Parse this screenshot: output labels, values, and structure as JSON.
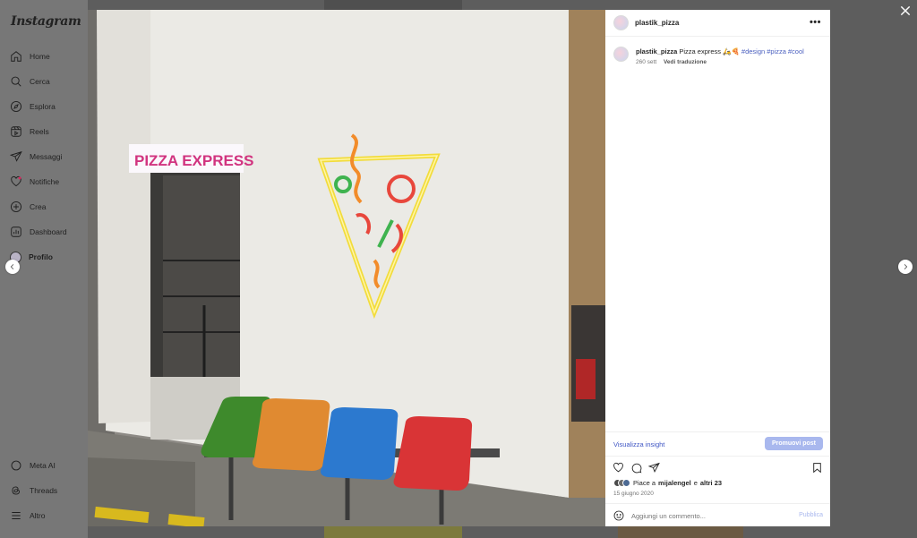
{
  "app": {
    "logo_text": "Instagram"
  },
  "sidebar": {
    "items": [
      {
        "label": "Home",
        "icon": "home-icon"
      },
      {
        "label": "Cerca",
        "icon": "search-icon"
      },
      {
        "label": "Esplora",
        "icon": "compass-icon"
      },
      {
        "label": "Reels",
        "icon": "reels-icon"
      },
      {
        "label": "Messaggi",
        "icon": "send-icon"
      },
      {
        "label": "Notifiche",
        "icon": "heart-icon"
      },
      {
        "label": "Crea",
        "icon": "plus-icon"
      },
      {
        "label": "Dashboard",
        "icon": "dashboard-icon"
      },
      {
        "label": "Profilo",
        "icon": "avatar"
      }
    ],
    "bottom_items": [
      {
        "label": "Meta AI",
        "icon": "meta-ai-icon"
      },
      {
        "label": "Threads",
        "icon": "threads-icon"
      },
      {
        "label": "Altro",
        "icon": "menu-icon"
      }
    ]
  },
  "post": {
    "photo": {
      "sign_text": "PIZZA EXPRESS"
    },
    "header": {
      "username": "plastik_pizza",
      "more": "•••"
    },
    "caption": {
      "username": "plastik_pizza",
      "text": "Pizza express 🛵🍕",
      "hashtags": [
        "#design",
        "#pizza",
        "#cool"
      ],
      "age": "260 sett",
      "translate": "Vedi traduzione"
    },
    "insights_label": "Visualizza insight",
    "promote_label": "Promuovi post",
    "likes": {
      "prefix": "Piace a",
      "user": "mijalengel",
      "joiner": "e",
      "others": "altri 23"
    },
    "date": "15 giugno 2020",
    "comment": {
      "placeholder": "Aggiungi un commento...",
      "publish_label": "Pubblica"
    }
  },
  "colors": {
    "accent_link": "#3f56c4",
    "promote_button": "#a9b8ee",
    "overlay": "#5d5d5d"
  }
}
